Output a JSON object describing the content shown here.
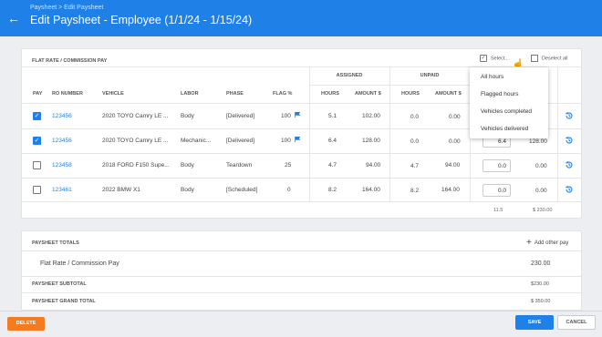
{
  "header": {
    "breadcrumb": "Paysheet > Edit Paysheet",
    "title": "Edit Paysheet - Employee (1/1/24 - 1/15/24)"
  },
  "flat_rate": {
    "title": "FLAT RATE / COMMISSION PAY",
    "select_label": "Select...",
    "deselect_label": "Deselect all",
    "groups": {
      "assigned": "ASSIGNED",
      "unpaid": "UNPAID"
    },
    "columns": [
      "PAY",
      "RO NUMBER",
      "VEHICLE",
      "LABOR",
      "PHASE",
      "FLAG %",
      "HOURS",
      "AMOUNT $",
      "HOURS",
      "AMOUNT $"
    ],
    "rows": [
      {
        "checked": true,
        "ro": "123456",
        "vehicle": "2020 TOYO Camry LE ...",
        "labor": "Body",
        "phase": "[Delivered]",
        "flag_pct": "100",
        "flagged": true,
        "a_hours": "5.1",
        "a_amount": "102.00",
        "u_hours": "0.0",
        "u_amount": "0.00",
        "pay_hours": "",
        "pay_amount": ""
      },
      {
        "checked": true,
        "ro": "123456",
        "vehicle": "2020 TOYO Camry LE ...",
        "labor": "Mechanic...",
        "phase": "[Delivered]",
        "flag_pct": "100",
        "flagged": true,
        "a_hours": "6.4",
        "a_amount": "128.00",
        "u_hours": "0.0",
        "u_amount": "0.00",
        "pay_hours": "6.4",
        "pay_amount": "128.00"
      },
      {
        "checked": false,
        "ro": "123458",
        "vehicle": "2018 FORD F150 Supe...",
        "labor": "Body",
        "phase": "Teardown",
        "flag_pct": "25",
        "flagged": false,
        "a_hours": "4.7",
        "a_amount": "94.00",
        "u_hours": "4.7",
        "u_amount": "94.00",
        "pay_hours": "0.0",
        "pay_amount": "0.00"
      },
      {
        "checked": false,
        "ro": "123461",
        "vehicle": "2022 BMW X1",
        "labor": "Body",
        "phase": "[Scheduled]",
        "flag_pct": "0",
        "flagged": false,
        "a_hours": "8.2",
        "a_amount": "164.00",
        "u_hours": "8.2",
        "u_amount": "164.00",
        "pay_hours": "0.0",
        "pay_amount": "0.00"
      }
    ],
    "totals": {
      "hours": "11.5",
      "amount": "$ 230.00"
    }
  },
  "select_menu": {
    "items": [
      "All hours",
      "Flagged hours",
      "Vehicles completed",
      "Vehicles delivered"
    ]
  },
  "paysheet_totals": {
    "title": "PAYSHEET TOTALS",
    "add_other_pay": "Add other pay",
    "flat_rate_label": "Flat Rate / Commission Pay",
    "flat_rate_value": "230.00",
    "subtotal_label": "PAYSHEET SUBTOTAL",
    "subtotal_value": "$230.00",
    "grand_total_label": "PAYSHEET GRAND TOTAL",
    "grand_total_value": "$ 350.00"
  },
  "footer": {
    "delete": "DELETE",
    "save": "SAVE",
    "cancel": "CANCEL"
  },
  "colors": {
    "primary": "#1f80e8",
    "danger": "#f47b20"
  }
}
